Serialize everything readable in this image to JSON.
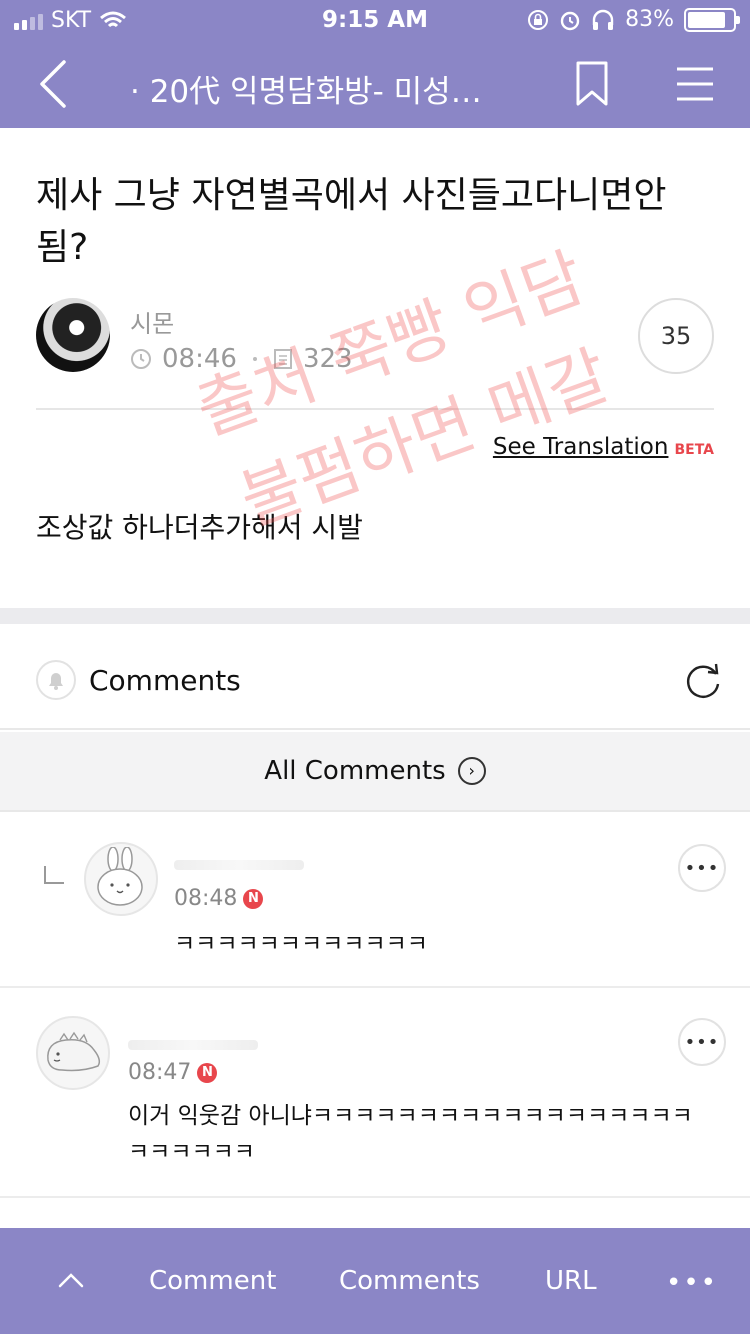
{
  "status_bar": {
    "carrier": "SKT",
    "time": "9:15 AM",
    "battery": "83%",
    "battery_level": 0.83
  },
  "nav": {
    "title": "· 20代 익명담화방- 미성…",
    "icons": [
      "back-icon",
      "bookmark-icon",
      "menu-icon"
    ]
  },
  "post": {
    "title": "제사 그냥 자연별곡에서 사진들고다니면안됨?",
    "author": "시몬",
    "time": "08:46",
    "views": "323",
    "likes": "35",
    "translate_label": "See Translation",
    "translate_badge": "BETA",
    "body": "조상값 하나더추가해서 시발",
    "watermark": [
      "출처 쭉빵 익담",
      "불펌하면 메갈"
    ],
    "watermark_color": "#f05050"
  },
  "comments_section": {
    "label": "Comments",
    "all_comments_label": "All Comments",
    "items": [
      {
        "time": "08:48",
        "badge": "N",
        "text": "ㅋㅋㅋㅋㅋㅋㅋㅋㅋㅋㅋㅋ",
        "is_reply": true,
        "avatar": "rabbit-avatar"
      },
      {
        "time": "08:47",
        "badge": "N",
        "text": "이거 익웃감 아니냐ㅋㅋㅋㅋㅋㅋㅋㅋㅋㅋㅋㅋㅋㅋㅋㅋㅋㅋㅋㅋㅋㅋㅋㅋ",
        "is_reply": false,
        "avatar": "dinosaur-avatar"
      }
    ]
  },
  "bottom_bar": {
    "comment_label": "Comment",
    "comments_label": "Comments",
    "url_label": "URL",
    "more_label": "•••"
  },
  "colors": {
    "accent": "#8b86c6",
    "badge": "#e8464c"
  }
}
